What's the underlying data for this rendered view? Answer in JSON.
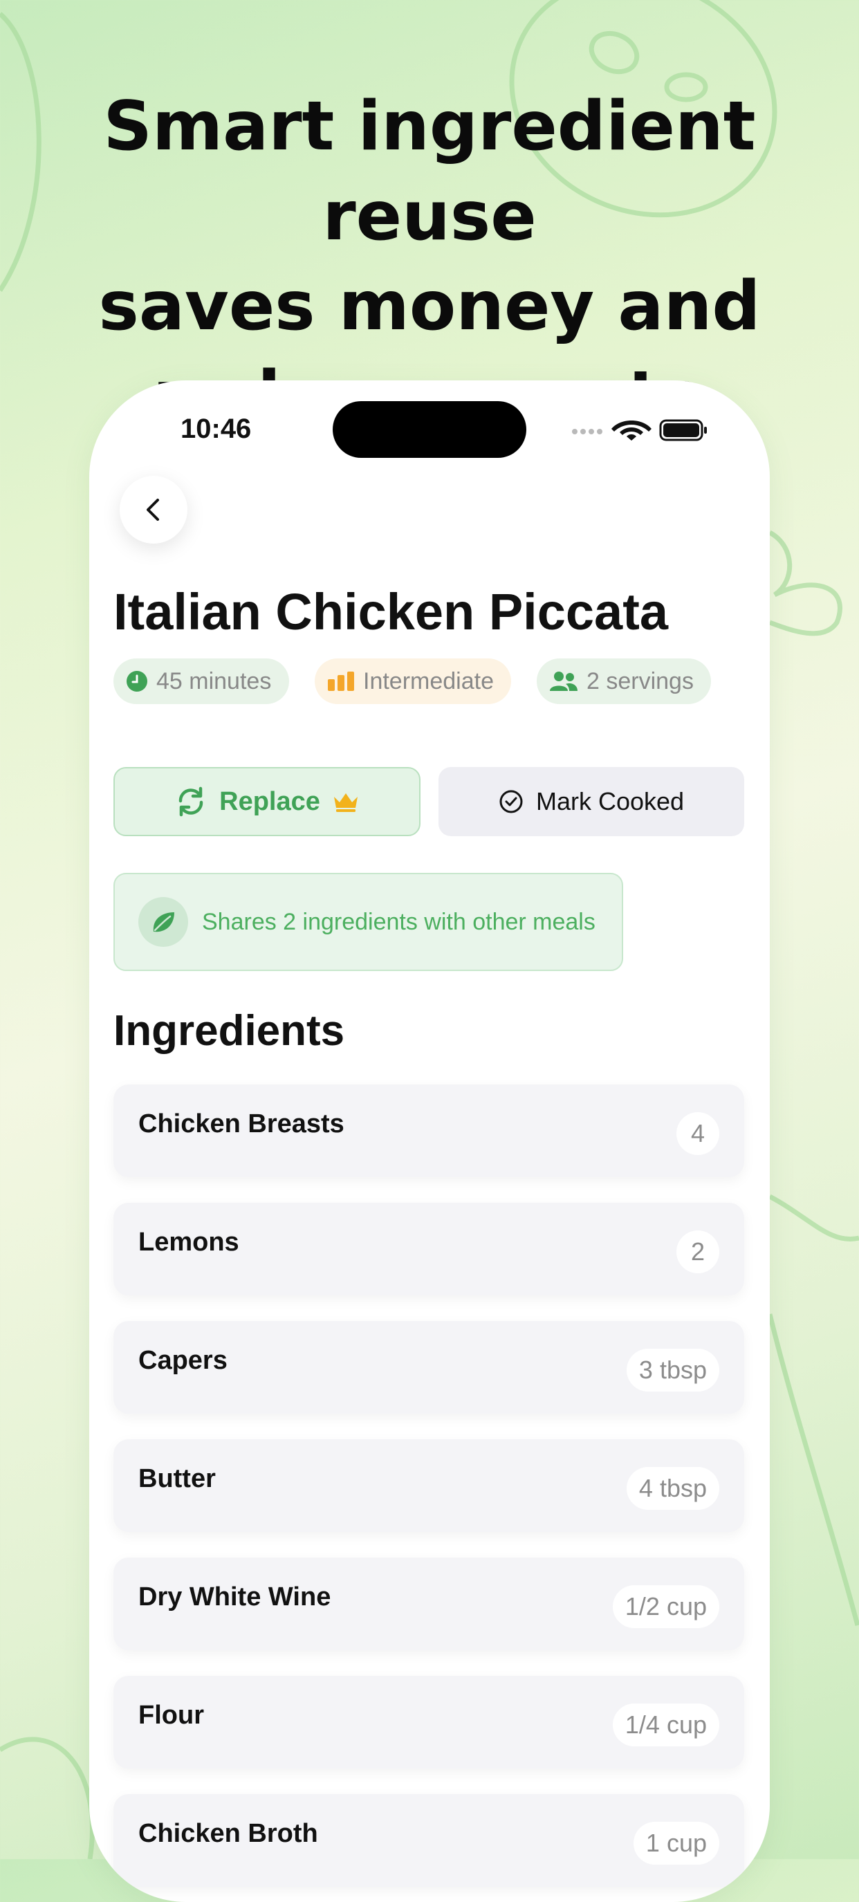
{
  "headline": {
    "line1": "Smart ingredient reuse",
    "line2": "saves money and",
    "line3": "reduces waste"
  },
  "status_bar": {
    "time": "10:46"
  },
  "recipe": {
    "title": "Italian Chicken Piccata",
    "meta": {
      "time": "45 minutes",
      "difficulty": "Intermediate",
      "servings": "2 servings"
    }
  },
  "actions": {
    "replace_label": "Replace",
    "mark_cooked_label": "Mark Cooked"
  },
  "share_notice": "Shares 2 ingredients with other meals",
  "ingredients_section": {
    "title": "Ingredients",
    "items": [
      {
        "name": "Chicken Breasts",
        "qty": "4"
      },
      {
        "name": "Lemons",
        "qty": "2"
      },
      {
        "name": "Capers",
        "qty": "3 tbsp"
      },
      {
        "name": "Butter",
        "qty": "4 tbsp"
      },
      {
        "name": "Dry White Wine",
        "qty": "1/2 cup"
      },
      {
        "name": "Flour",
        "qty": "1/4 cup"
      },
      {
        "name": "Chicken Broth",
        "qty": "1 cup"
      }
    ]
  },
  "colors": {
    "accent_green": "#3fa256",
    "crown_gold": "#f2b21b",
    "difficulty_orange": "#f4a62a"
  }
}
